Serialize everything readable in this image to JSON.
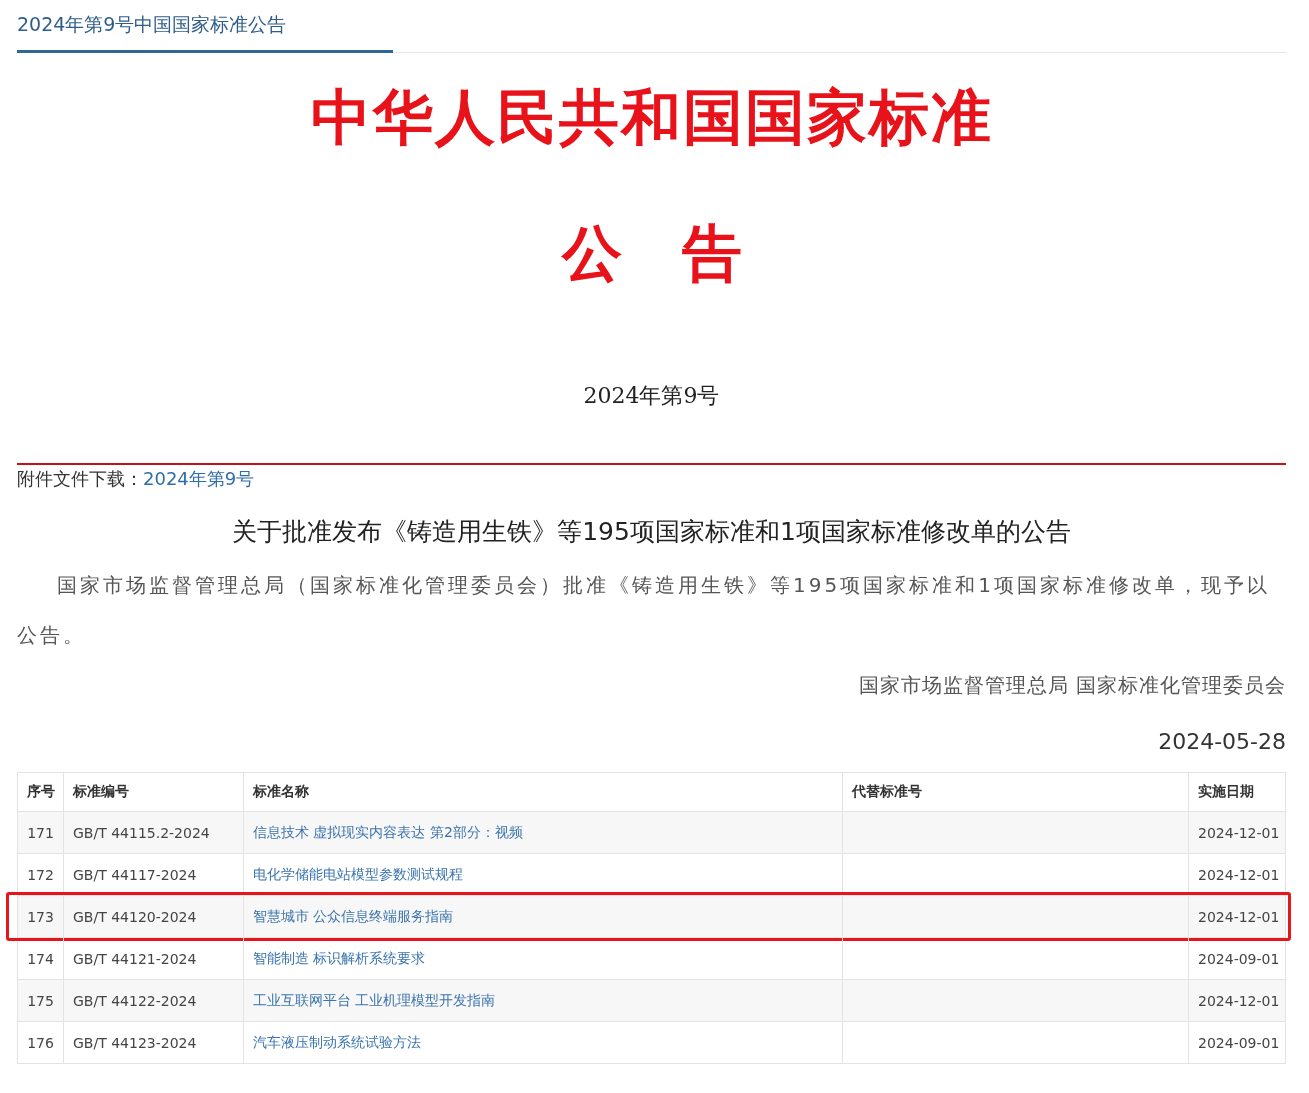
{
  "tab": {
    "label": "2024年第9号中国国家标准公告",
    "selected": true
  },
  "header": {
    "title": "中华人民共和国国家标准",
    "subtitle": "公　告",
    "number": "2024年第9号"
  },
  "attachment": {
    "label": "附件文件下载：",
    "link": "2024年第9号"
  },
  "announcement": {
    "heading": "关于批准发布《铸造用生铁》等195项国家标准和1项国家标准修改单的公告",
    "body": "国家市场监督管理总局（国家标准化管理委员会）批准《铸造用生铁》等195项国家标准和1项国家标准修改单，现予以公告。",
    "signature": "国家市场监督管理总局 国家标准化管理委员会",
    "date": "2024-05-28"
  },
  "table": {
    "columns": [
      "序号",
      "标准编号",
      "标准名称",
      "代替标准号",
      "实施日期"
    ],
    "rows": [
      {
        "index": "171",
        "code": "GB/T 44115.2-2024",
        "name": "信息技术 虚拟现实内容表达 第2部分：视频",
        "date": "2024-12-01",
        "highlighted": false
      },
      {
        "index": "172",
        "code": "GB/T 44117-2024",
        "name": "电化学储能电站模型参数测试规程",
        "date": "2024-12-01",
        "highlighted": false
      },
      {
        "index": "173",
        "code": "GB/T 44120-2024",
        "name": "智慧城市 公众信息终端服务指南",
        "date": "2024-12-01",
        "highlighted": true
      },
      {
        "index": "174",
        "code": "GB/T 44121-2024",
        "name": "智能制造 标识解析系统要求",
        "date": "2024-09-01",
        "highlighted": false
      },
      {
        "index": "175",
        "code": "GB/T 44122-2024",
        "name": "工业互联网平台 工业机理模型开发指南",
        "date": "2024-12-01",
        "highlighted": false
      },
      {
        "index": "176",
        "code": "GB/T 44123-2024",
        "name": "汽车液压制动系统试验方法",
        "date": "2024-09-01",
        "highlighted": false
      }
    ]
  }
}
